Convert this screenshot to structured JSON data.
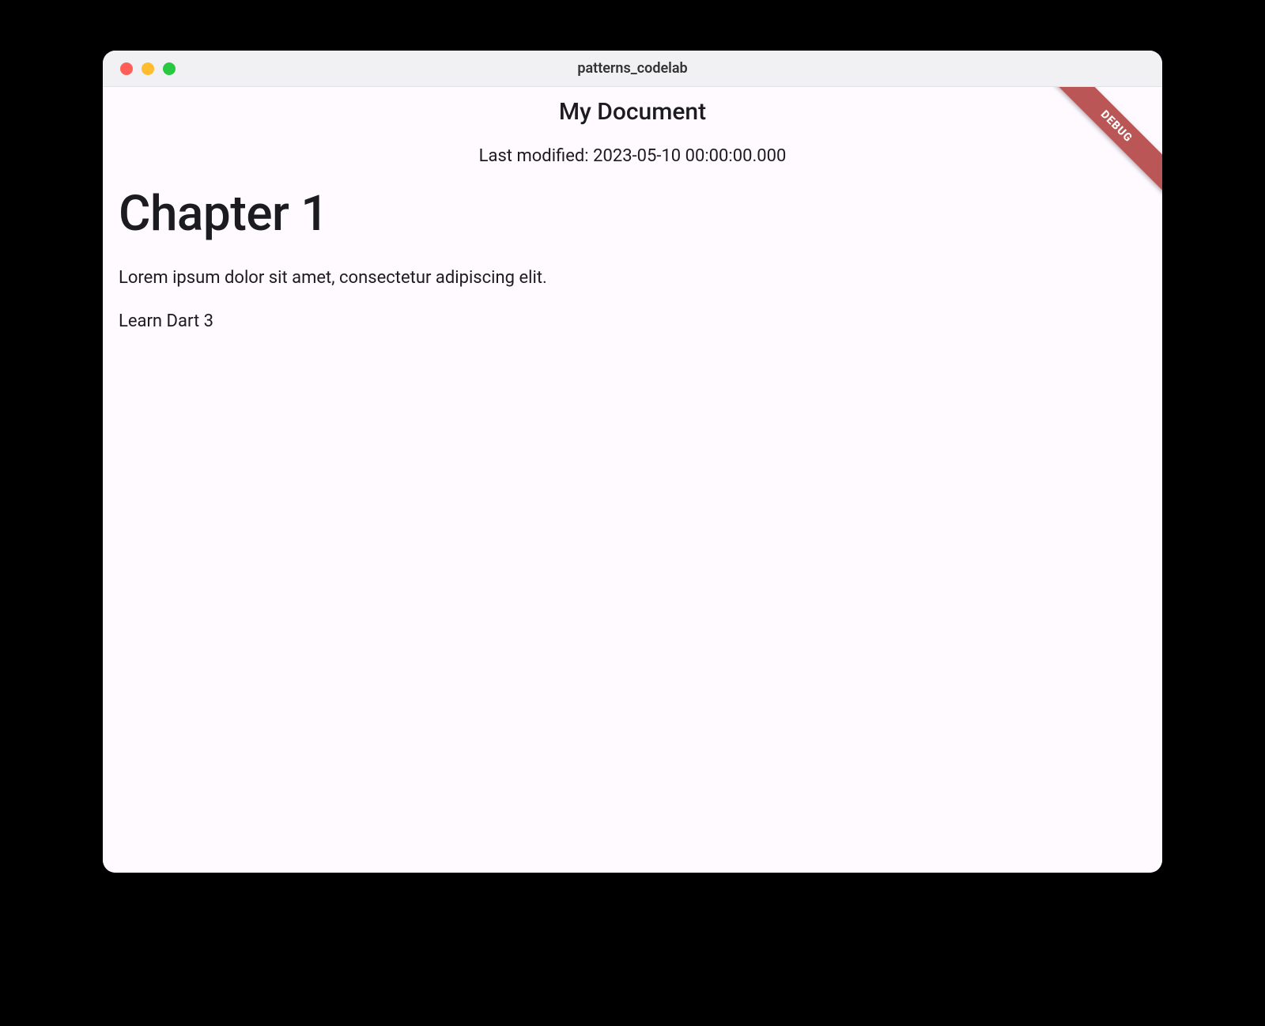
{
  "window": {
    "title": "patterns_codelab"
  },
  "debug": {
    "label": "DEBUG"
  },
  "appbar": {
    "title": "My Document"
  },
  "subtitle": "Last modified: 2023-05-10 00:00:00.000",
  "document": {
    "heading": "Chapter 1",
    "paragraph": "Lorem ipsum dolor sit amet, consectetur adipiscing elit.",
    "task": "Learn Dart 3"
  }
}
